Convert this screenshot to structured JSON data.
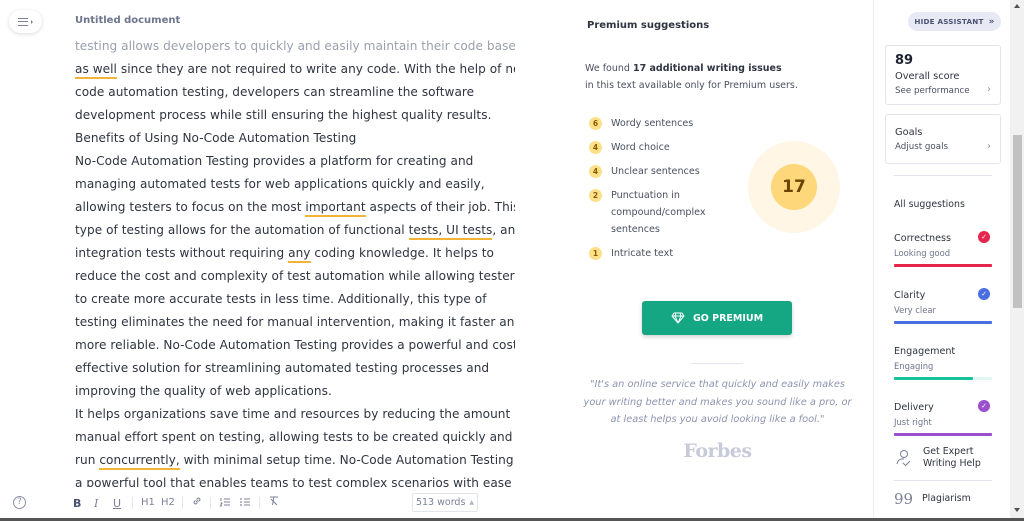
{
  "editor": {
    "menu_icon": "menu-icon",
    "doc_title": "Untitled document",
    "lines": [
      {
        "parts": [
          {
            "t": "testing allows developers to quickly and easily maintain their code base"
          }
        ],
        "faded": true
      },
      {
        "parts": [
          {
            "t": "as well",
            "u": true
          },
          {
            "t": " since they are not required to write any code. With the help of no-"
          }
        ]
      },
      {
        "parts": [
          {
            "t": "code automation testing, developers can streamline the software"
          }
        ]
      },
      {
        "parts": [
          {
            "t": "development process while still ensuring the highest quality results."
          }
        ]
      },
      {
        "parts": [
          {
            "t": "Benefits of Using No-Code Automation Testing"
          }
        ]
      },
      {
        "parts": [
          {
            "t": "No-Code Automation Testing provides a platform for creating and"
          }
        ]
      },
      {
        "parts": [
          {
            "t": "managing automated tests for web applications quickly and easily,"
          }
        ]
      },
      {
        "parts": [
          {
            "t": "allowing testers to focus on the most "
          },
          {
            "t": "important",
            "u": true
          },
          {
            "t": " aspects of their job. This"
          }
        ]
      },
      {
        "parts": [
          {
            "t": "type of testing allows for the automation of functional "
          },
          {
            "t": "tests, UI tests",
            "u": true
          },
          {
            "t": ", and"
          }
        ]
      },
      {
        "parts": [
          {
            "t": "integration tests without requiring "
          },
          {
            "t": "any",
            "u": true
          },
          {
            "t": " coding knowledge. It helps to"
          }
        ]
      },
      {
        "parts": [
          {
            "t": "reduce the cost and complexity of test automation while allowing testers"
          }
        ]
      },
      {
        "parts": [
          {
            "t": "to create more accurate tests in less time. Additionally, this type of"
          }
        ]
      },
      {
        "parts": [
          {
            "t": "testing eliminates the need for manual intervention, making it faster and"
          }
        ]
      },
      {
        "parts": [
          {
            "t": "more reliable. No-Code Automation Testing provides a powerful and cost-"
          }
        ]
      },
      {
        "parts": [
          {
            "t": "effective solution for streamlining automated testing processes and"
          }
        ]
      },
      {
        "parts": [
          {
            "t": "improving the quality of web applications."
          }
        ]
      },
      {
        "parts": [
          {
            "t": "It helps organizations save time and resources by reducing the amount of"
          }
        ]
      },
      {
        "parts": [
          {
            "t": "manual effort spent on testing, allowing tests to be created quickly and"
          }
        ]
      },
      {
        "parts": [
          {
            "t": "run "
          },
          {
            "t": "concurrently,",
            "u": true
          },
          {
            "t": " with minimal setup time. No-Code Automation Testing is"
          }
        ]
      },
      {
        "parts": [
          {
            "t": "a powerful tool that enables teams to test complex scenarios with ease"
          }
        ]
      }
    ],
    "toolbar": {
      "help": "?",
      "bold": "B",
      "italic": "I",
      "underline": "U",
      "h1": "H1",
      "h2": "H2",
      "link_icon": "link-icon",
      "ordered_list_icon": "ordered-list-icon",
      "bullet_list_icon": "bullet-list-icon",
      "clear_format_icon": "clear-format-icon",
      "word_count": "513 words"
    }
  },
  "premium": {
    "title": "Premium suggestions",
    "found_prefix": "We found ",
    "found_bold": "17 additional writing issues",
    "found_suffix": "in this text available only for Premium users.",
    "issues": [
      {
        "count": "6",
        "label": "Wordy sentences"
      },
      {
        "count": "4",
        "label": "Word choice"
      },
      {
        "count": "4",
        "label": "Unclear sentences"
      },
      {
        "count": "2",
        "label": "Punctuation in compound/complex sentences"
      },
      {
        "count": "1",
        "label": "Intricate text"
      }
    ],
    "total": "17",
    "button_label": "GO PREMIUM",
    "quote": "\"It's an online service that quickly and easily makes your writing better and makes you sound like a pro, or at least helps you avoid looking like a fool.\"",
    "quote_source": "Forbes"
  },
  "assistant": {
    "hide_label": "HIDE ASSISTANT",
    "overall": {
      "score": "89",
      "title": "Overall score",
      "link": "See performance"
    },
    "goals": {
      "title": "Goals",
      "link": "Adjust goals"
    },
    "all_suggestions": "All suggestions",
    "categories": [
      {
        "name": "Correctness",
        "status": "Looking good",
        "color": "#e5254b",
        "progress": 1.0,
        "checked": true
      },
      {
        "name": "Clarity",
        "status": "Very clear",
        "color": "#4a6ee0",
        "progress": 1.0,
        "checked": true
      },
      {
        "name": "Engagement",
        "status": "Engaging",
        "color": "#15c39a",
        "progress": 0.81,
        "checked": false
      },
      {
        "name": "Delivery",
        "status": "Just right",
        "color": "#9b4fcf",
        "progress": 1.0,
        "checked": true
      }
    ],
    "expert_help": "Get Expert Writing Help",
    "plagiarism": "Plagiarism"
  }
}
